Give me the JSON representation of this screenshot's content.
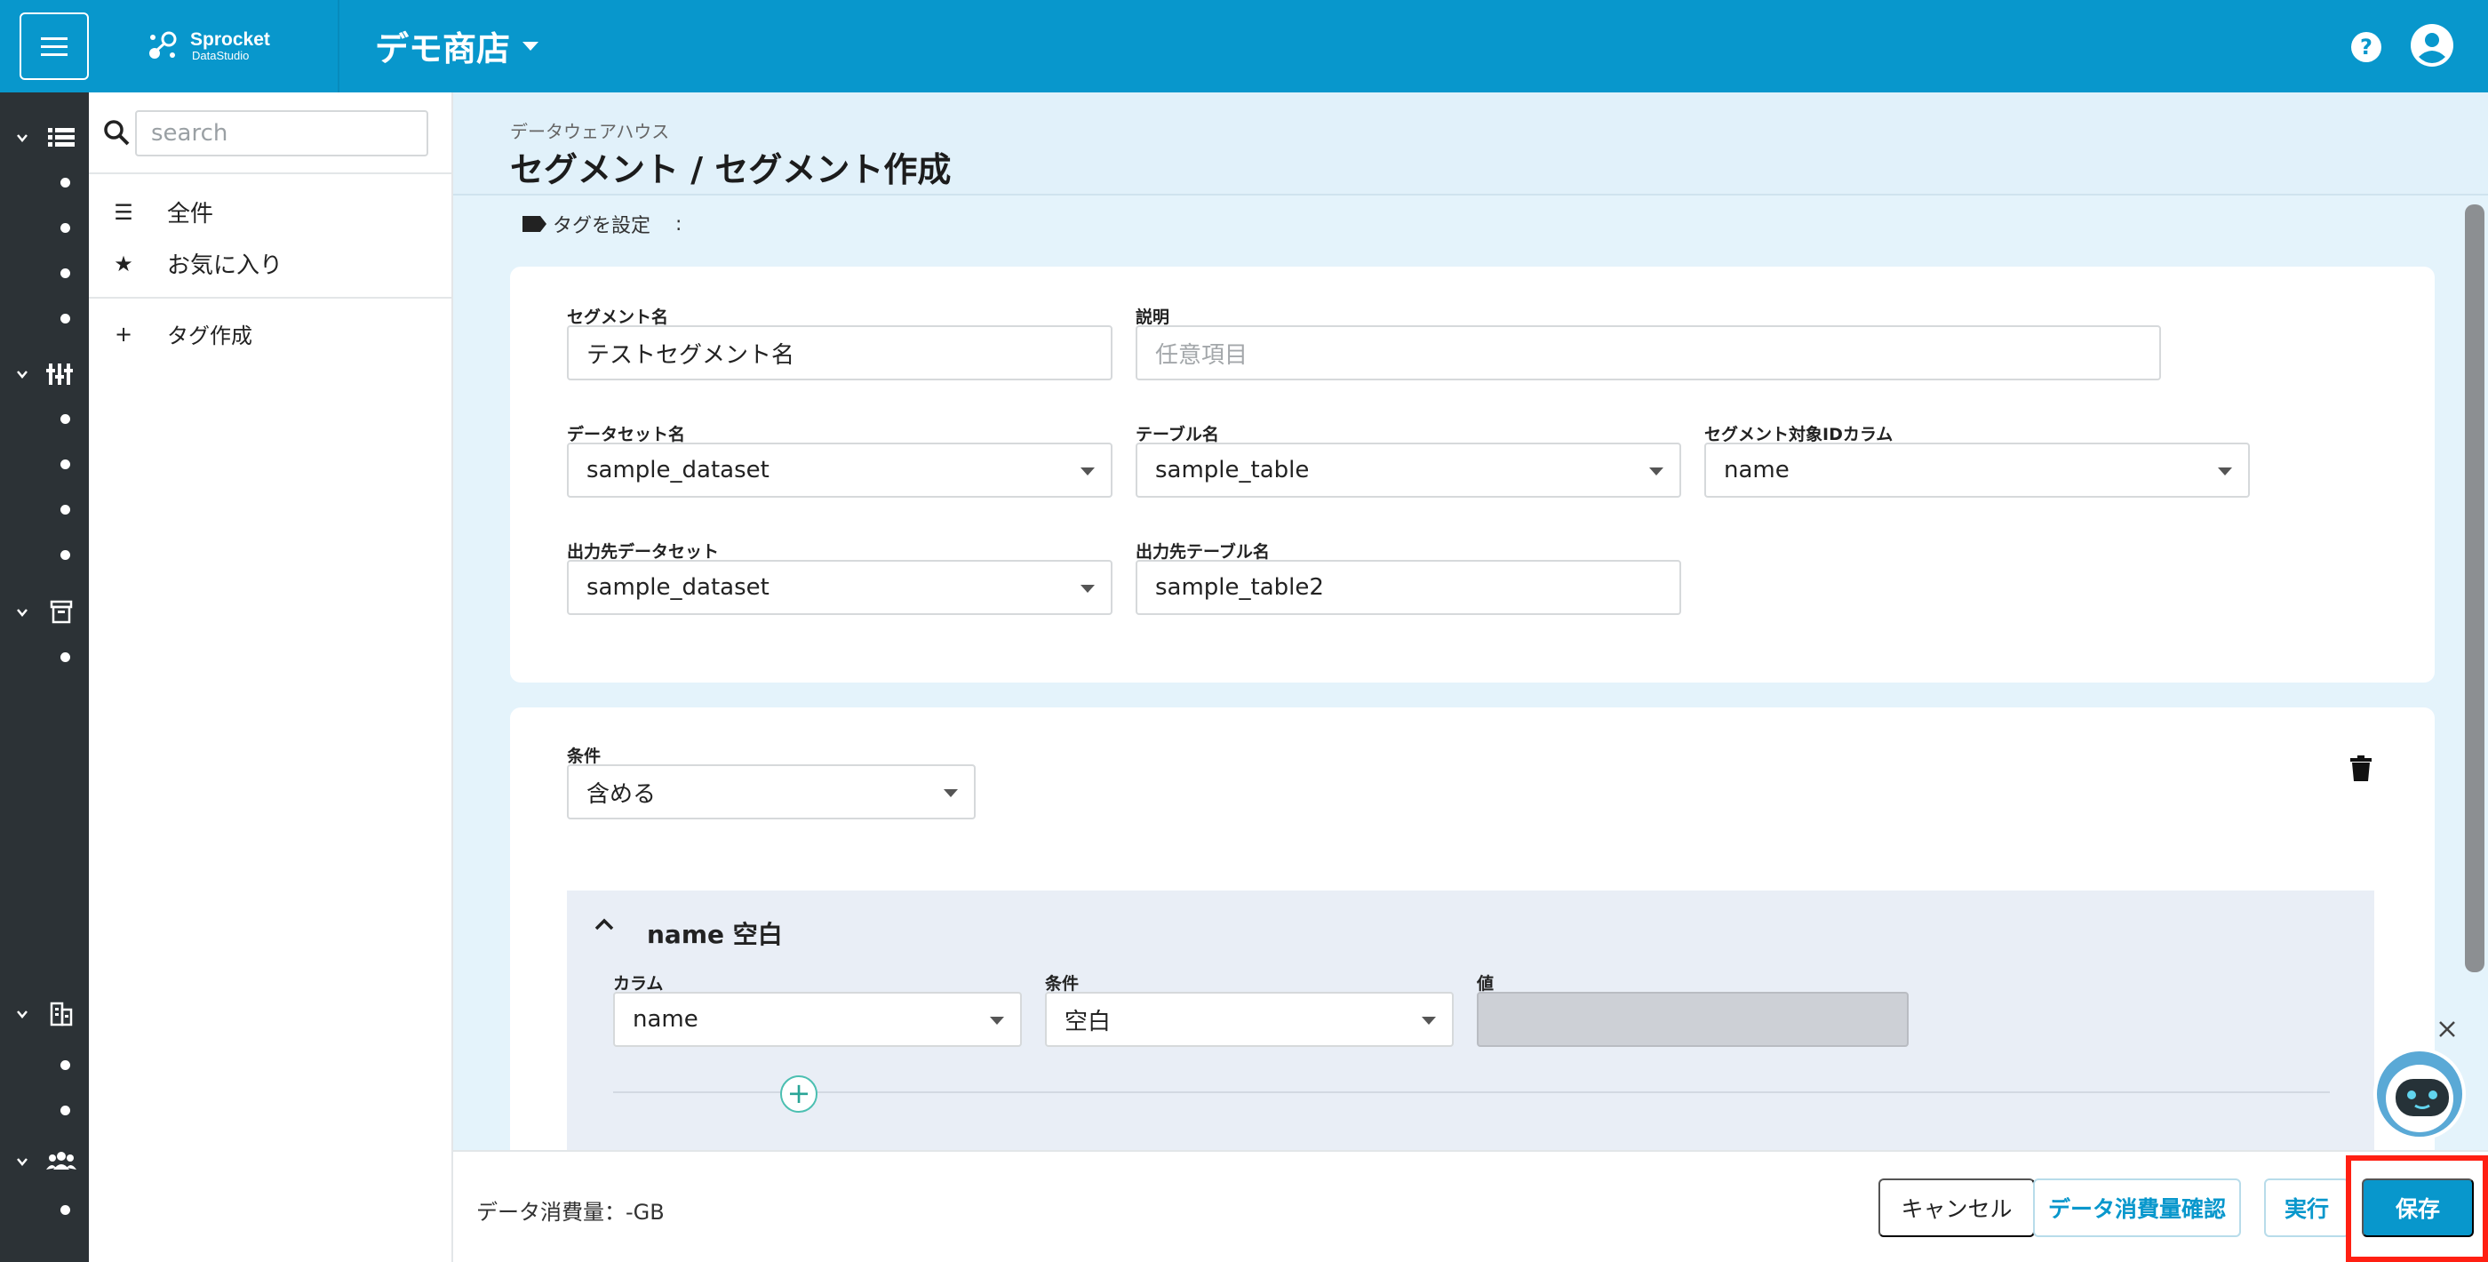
{
  "header": {
    "brand_name": "Sprocket",
    "brand_sub": "DataStudio",
    "store_name": "デモ商店",
    "help_glyph": "?"
  },
  "sidebar": {
    "search_placeholder": "search",
    "items": [
      {
        "label": "全件",
        "icon": "list-icon"
      },
      {
        "label": "お気に入り",
        "icon": "star-icon"
      },
      {
        "label": "タグ作成",
        "icon": "plus-icon"
      }
    ]
  },
  "page": {
    "breadcrumb": "データウェアハウス",
    "title": "セグメント / セグメント作成",
    "tag_label": "タグを設定",
    "tag_colon": ":"
  },
  "form": {
    "segment_name": {
      "label": "セグメント名",
      "value": "テストセグメント名"
    },
    "description": {
      "label": "説明",
      "placeholder": "任意項目"
    },
    "dataset": {
      "label": "データセット名",
      "value": "sample_dataset"
    },
    "table": {
      "label": "テーブル名",
      "value": "sample_table"
    },
    "id_column": {
      "label": "セグメント対象IDカラム",
      "value": "name"
    },
    "output_dataset": {
      "label": "出力先データセット",
      "value": "sample_dataset"
    },
    "output_table": {
      "label": "出力先テーブル名",
      "value": "sample_table2"
    }
  },
  "condition": {
    "label": "条件",
    "value": "含める",
    "group_title": "name 空白",
    "column_label": "カラム",
    "column_value": "name",
    "op_label": "条件",
    "op_value": "空白",
    "value_label": "値",
    "value_value": "",
    "add_glyph": "+"
  },
  "footer": {
    "usage": "データ消費量：-GB",
    "cancel": "キャンセル",
    "estimate": "データ消費量確認",
    "run": "実行",
    "save": "保存"
  },
  "colors": {
    "header": "#0897cc",
    "rail": "#2c3236",
    "main_bg": "#e4f3fb",
    "highlight": "#ff1f12",
    "add_button": "#4bbfb1"
  }
}
